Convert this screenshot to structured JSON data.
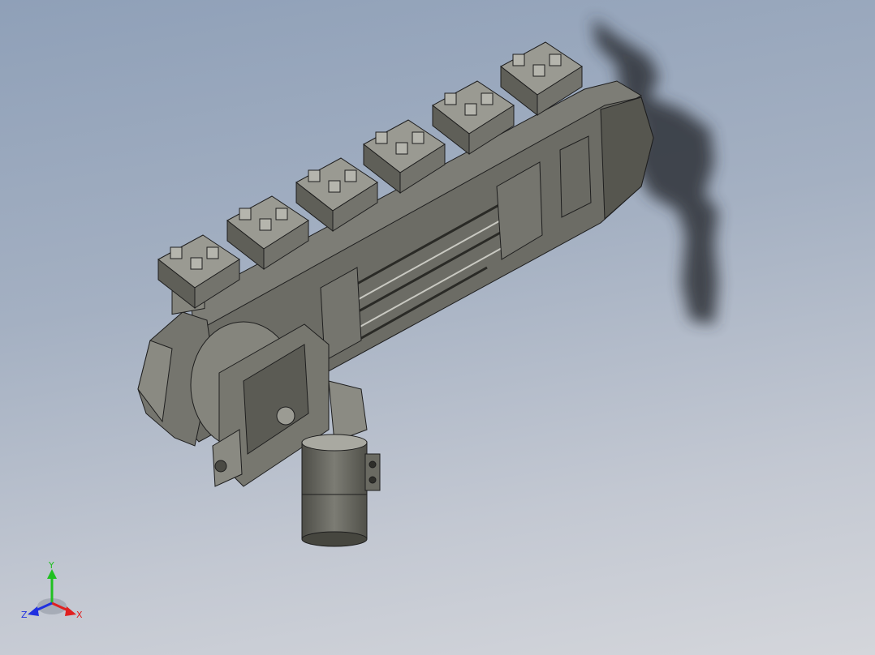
{
  "viewport": {
    "background_top": "#8fa0b8",
    "background_bottom": "#d4d6db"
  },
  "model": {
    "body_color": "#6f6f68",
    "body_light": "#8a8a82",
    "body_dark": "#45453f",
    "edge_color": "#1e1e1e",
    "shadow_color": "#2e3238",
    "fixture_count": 6
  },
  "triad": {
    "x_label": "X",
    "y_label": "Y",
    "z_label": "Z",
    "x_color": "#e02020",
    "y_color": "#20c020",
    "z_color": "#2030e0"
  }
}
